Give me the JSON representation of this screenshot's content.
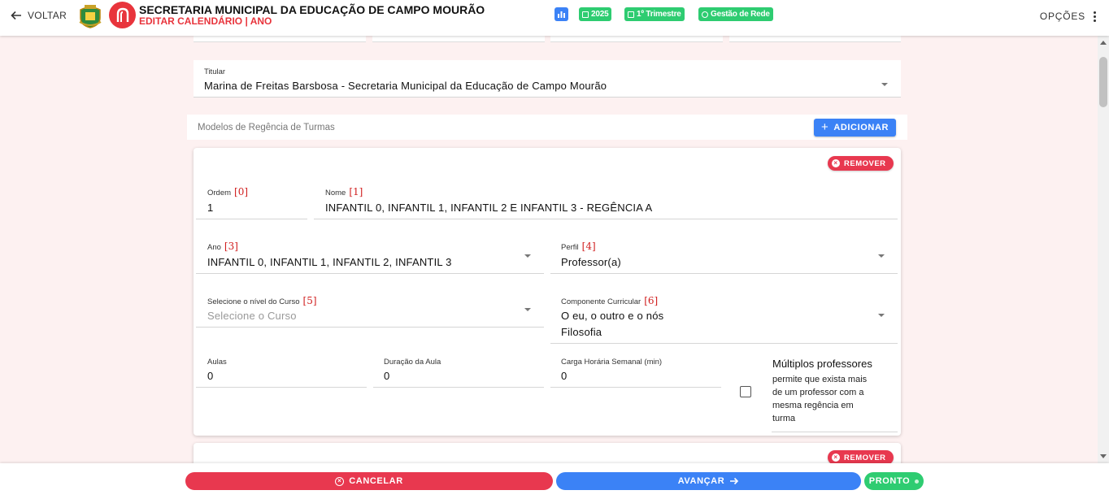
{
  "header": {
    "back_label": "VOLTAR",
    "org_title": "SECRETARIA MUNICIPAL DA EDUCAÇÃO DE CAMPO MOURÃO",
    "org_subtitle": "EDITAR CALENDÁRIO | ANO",
    "chips": [
      {
        "label": "2025",
        "icon": "calendar-icon"
      },
      {
        "label": "1º Trimestre",
        "icon": "calendar-icon"
      },
      {
        "label": "Gestão de Rede",
        "icon": "check-circle-icon"
      }
    ],
    "options_label": "OPÇÕES",
    "colors": {
      "accent_red": "#e8343c",
      "chip_green": "#2ecc71",
      "chart_chip_blue": "#3b82f6"
    }
  },
  "titular": {
    "label": "Titular",
    "value": "Marina de Freitas Barsbosa - Secretaria Municipal da Educação de Campo Mourão"
  },
  "regencia": {
    "section_label": "Modelos de Regência de Turmas",
    "add_label": "ADICIONAR",
    "remove_label": "REMOVER",
    "card": {
      "ordem": {
        "label": "Ordem",
        "index": "[0]",
        "value": "1"
      },
      "nome": {
        "label": "Nome",
        "index": "[1]",
        "value": "INFANTIL 0, INFANTIL 1, INFANTIL 2 E INFANTIL 3 - REGÊNCIA A"
      },
      "ano": {
        "label": "Ano",
        "index": "[3]",
        "value": "INFANTIL 0, INFANTIL 1, INFANTIL 2, INFANTIL 3"
      },
      "perfil": {
        "label": "Perfil",
        "index": "[4]",
        "value": "Professor(a)"
      },
      "curso": {
        "label": "Selecione o nível do Curso",
        "index": "[5]",
        "placeholder": "Selecione o Curso"
      },
      "componente": {
        "label": "Componente Curricular",
        "index": "[6]",
        "values": [
          "O eu, o outro e o nós",
          "Filosofia"
        ]
      },
      "aulas": {
        "label": "Aulas",
        "value": "0"
      },
      "duracao": {
        "label": "Duração da Aula",
        "value": "0"
      },
      "carga": {
        "label": "Carga Horária Semanal (min)",
        "value": "0"
      },
      "multiplos": {
        "title": "Múltiplos professores",
        "description_lines": [
          "permite que exista mais",
          "de um professor com a",
          "mesma regência em",
          "turma"
        ],
        "checked": false
      }
    }
  },
  "footer": {
    "cancel_label": "CANCELAR",
    "next_label": "AVANÇAR",
    "done_label": "PRONTO",
    "colors": {
      "cancel": "#e8384f",
      "next": "#3b82f6",
      "done": "#2ecc71"
    }
  }
}
